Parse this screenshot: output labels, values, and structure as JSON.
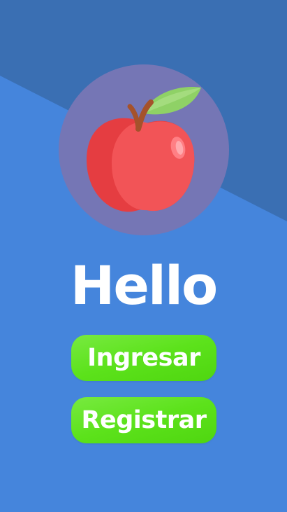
{
  "colors": {
    "background": "#4585dc",
    "background_top": "#3a6fb3",
    "logo_circle": "#7576b5",
    "button": "#5ce21b",
    "text": "#ffffff"
  },
  "logo": {
    "icon": "apple-icon"
  },
  "main": {
    "title": "Hello",
    "login_label": "Ingresar",
    "register_label": "Registrar"
  }
}
